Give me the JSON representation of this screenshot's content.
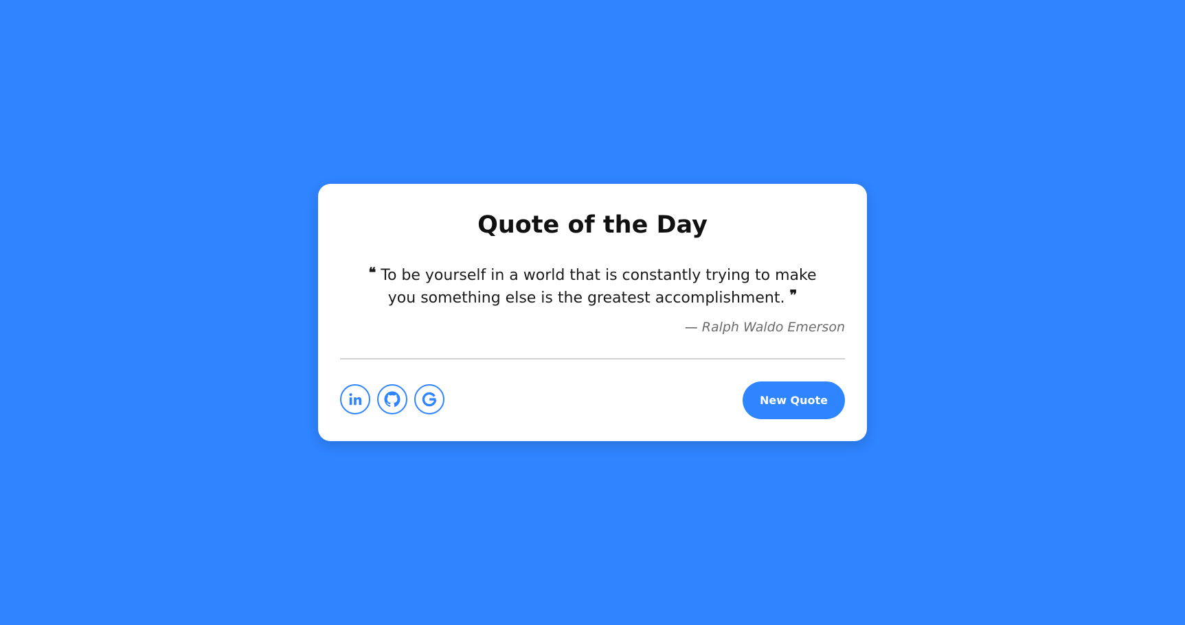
{
  "page": {
    "background_color": "#2f84ff"
  },
  "card": {
    "title": "Quote of the Day",
    "quote": {
      "open_mark": "❝",
      "text": "To be yourself in a world that is constantly trying to make you something else is the greatest accomplishment.",
      "close_mark": "❞"
    },
    "author": {
      "dash": "—",
      "name": "Ralph Waldo Emerson"
    },
    "social": [
      {
        "icon": "linkedin-icon",
        "color": "#2f84ff"
      },
      {
        "icon": "github-icon",
        "color": "#2f84ff"
      },
      {
        "icon": "google-icon",
        "color": "#2f84ff"
      }
    ],
    "new_quote_label": "New Quote"
  },
  "colors": {
    "accent": "#2f84ff",
    "card_bg": "#ffffff",
    "author_text": "#6b6b6b",
    "divider": "#d2d2d2"
  }
}
